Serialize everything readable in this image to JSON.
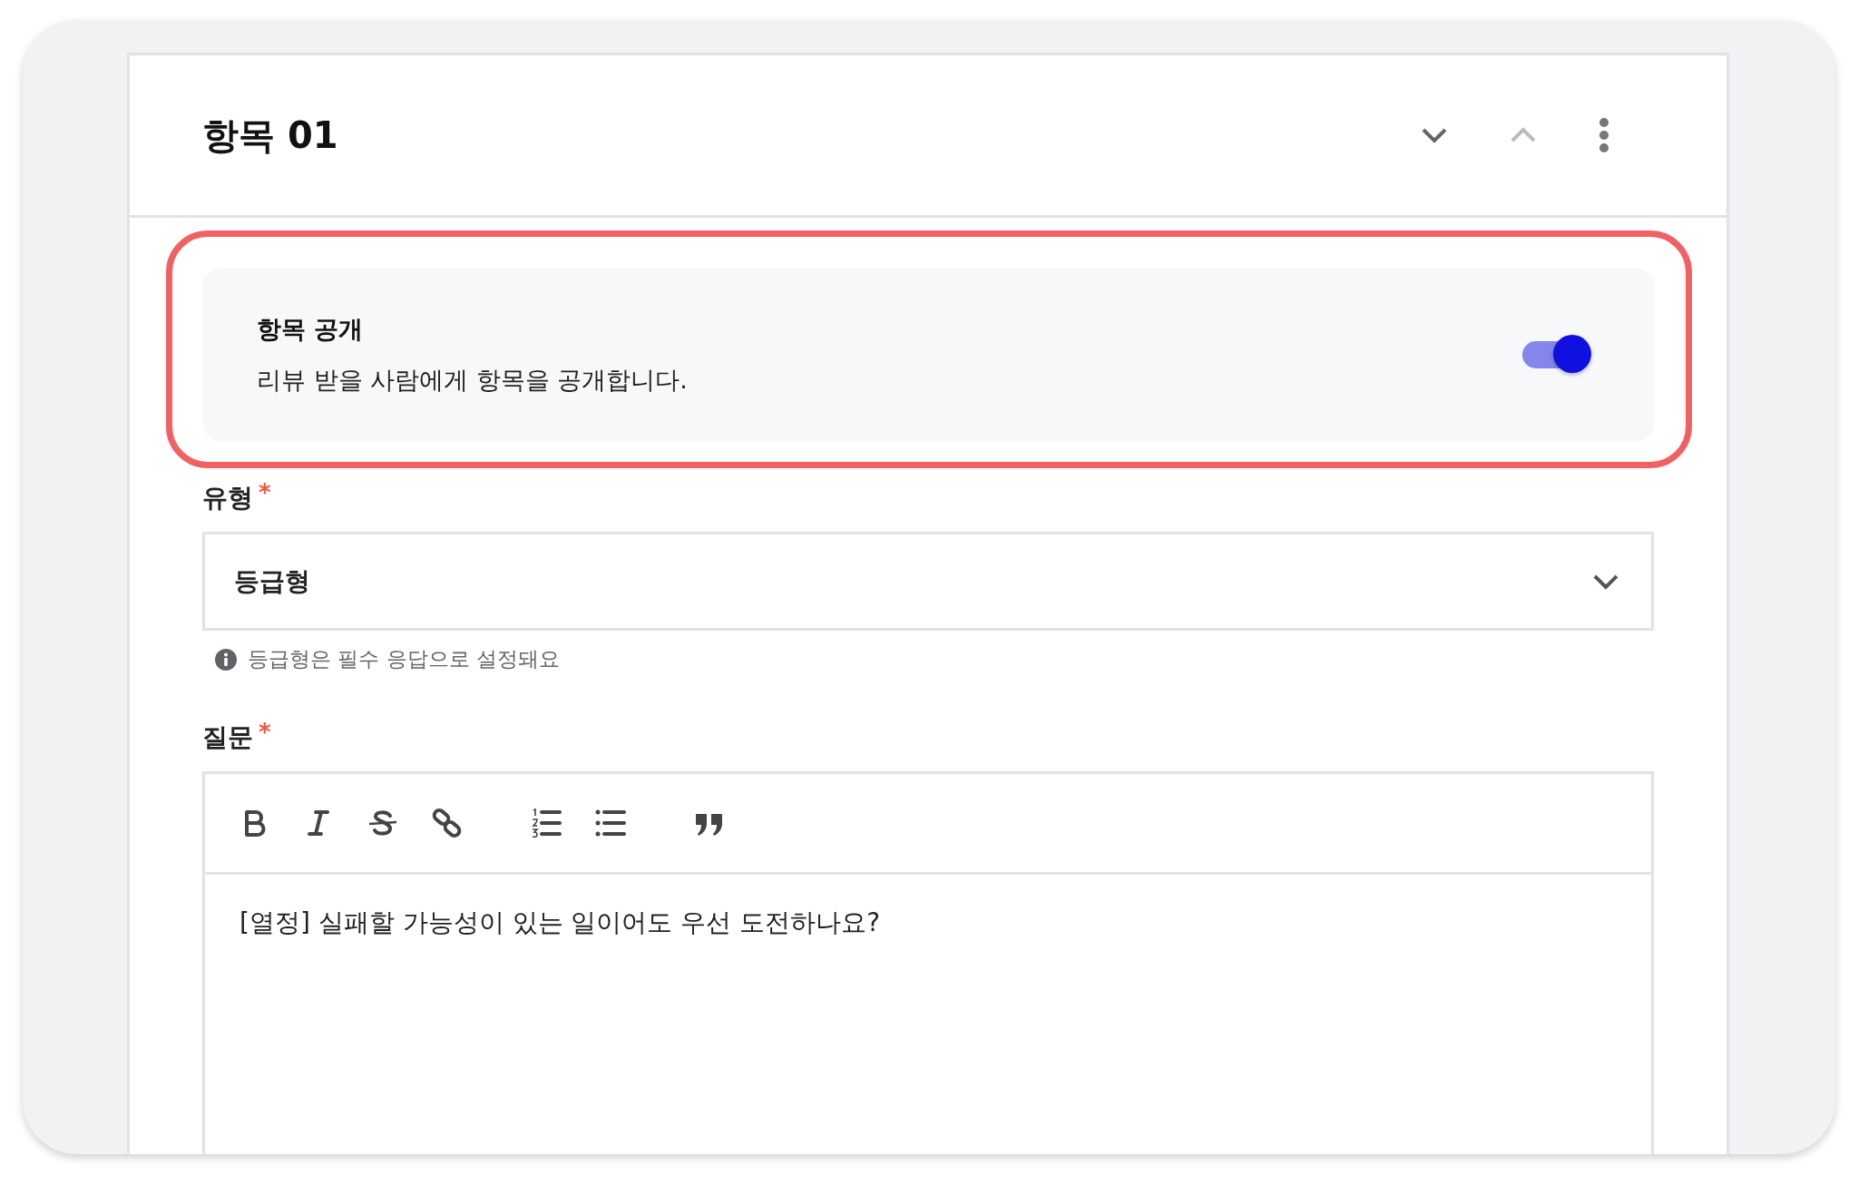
{
  "header": {
    "title": "항목 01",
    "move_down": {
      "disabled": false
    },
    "move_up": {
      "disabled": true
    }
  },
  "visibility": {
    "title": "항목 공개",
    "description": "리뷰 받을 사람에게 항목을 공개합니다.",
    "on": true,
    "highlighted": true
  },
  "type_field": {
    "label": "유형",
    "required_mark": "*",
    "value": "등급형",
    "hint": "등급형은 필수 응답으로 설정돼요"
  },
  "question_field": {
    "label": "질문",
    "required_mark": "*",
    "toolbar": [
      {
        "kind": "bold"
      },
      {
        "kind": "italic"
      },
      {
        "kind": "strike"
      },
      {
        "kind": "link"
      },
      {
        "kind": "ordered-list"
      },
      {
        "kind": "bullet-list"
      },
      {
        "kind": "quote"
      }
    ],
    "value": "[열정] 실패할 가능성이 있는 일이어도 우선 도전하나요?"
  }
}
